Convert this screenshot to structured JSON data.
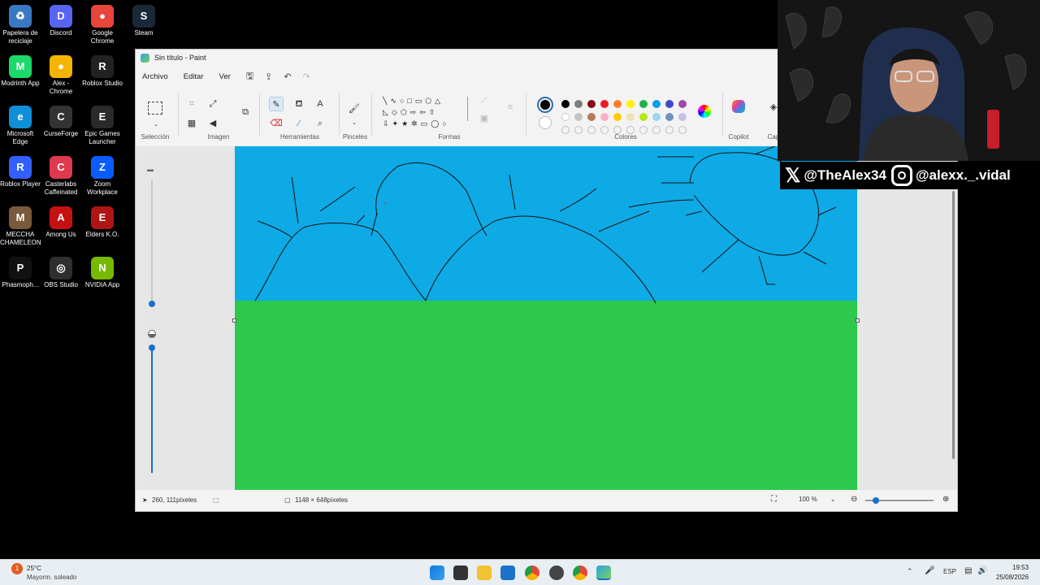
{
  "desktop": {
    "icons": [
      {
        "label": "Papelera de reciclaje",
        "color": "#3b78c4",
        "glyph": "♻"
      },
      {
        "label": "Discord",
        "color": "#5865f2",
        "glyph": "D"
      },
      {
        "label": "Google Chrome",
        "color": "#e8453c",
        "glyph": "●"
      },
      {
        "label": "Steam",
        "color": "#1b2838",
        "glyph": "S"
      },
      {
        "label": "Modrinth App",
        "color": "#1bd96a",
        "glyph": "M"
      },
      {
        "label": "Alex - Chrome",
        "color": "#f4b400",
        "glyph": "●"
      },
      {
        "label": "Roblox Studio",
        "color": "#222222",
        "glyph": "R"
      },
      {
        "label": "Microsoft Edge",
        "color": "#0f8fd8",
        "glyph": "e"
      },
      {
        "label": "CurseForge",
        "color": "#333333",
        "glyph": "C"
      },
      {
        "label": "Epic Games Launcher",
        "color": "#2a2a2a",
        "glyph": "E"
      },
      {
        "label": "Roblox Player",
        "color": "#335fff",
        "glyph": "R"
      },
      {
        "label": "Casterlabs Caffeinated",
        "color": "#e0394f",
        "glyph": "C"
      },
      {
        "label": "Zoom Workplace",
        "color": "#0b5cff",
        "glyph": "Z"
      },
      {
        "label": "MECCHA CHAMELEON",
        "color": "#7a5a3a",
        "glyph": "M"
      },
      {
        "label": "Among Us",
        "color": "#c51111",
        "glyph": "A"
      },
      {
        "label": "Elders K.O.",
        "color": "#b01515",
        "glyph": "E"
      },
      {
        "label": "Phasmoph...",
        "color": "#111111",
        "glyph": "P"
      },
      {
        "label": "OBS Studio",
        "color": "#302e31",
        "glyph": "◎"
      },
      {
        "label": "NVIDIA App",
        "color": "#76b900",
        "glyph": "N"
      }
    ]
  },
  "paint": {
    "title": "Sin título - Paint",
    "menus": [
      "Archivo",
      "Editar",
      "Ver"
    ],
    "groups": {
      "seleccion": "Selección",
      "imagen": "Imagen",
      "herramientas": "Herramientas",
      "pinceles": "Pinceles",
      "formas": "Formas",
      "colores": "Colores",
      "copilot": "Copilot",
      "capas": "Cap"
    },
    "colors": {
      "row1": [
        "#000000",
        "#7f7f7f",
        "#880015",
        "#ed1c24",
        "#ff7f27",
        "#fff200",
        "#22b14c",
        "#00a2e8",
        "#3f48cc",
        "#a349a4"
      ],
      "row2": [
        "#ffffff",
        "#c3c3c3",
        "#b97a57",
        "#ffaec9",
        "#ffc90e",
        "#efe4b0",
        "#b5e61d",
        "#99d9ea",
        "#7092be",
        "#c8bfe7"
      ],
      "sky": "#0eaae6",
      "grass": "#2dc84e"
    },
    "status": {
      "cursor": "260, 111píxeles",
      "size": "1148 × 648píxeles",
      "zoom": "100 %"
    }
  },
  "overlay": {
    "twitter": "@TheAlex34",
    "instagram": "@alexx._.vidal"
  },
  "taskbar": {
    "weather_temp": "25°C",
    "weather_desc": "Mayorm. soleado",
    "lang": "ESP",
    "time": "19:53",
    "date": "25/08/2026",
    "notif": "1"
  }
}
